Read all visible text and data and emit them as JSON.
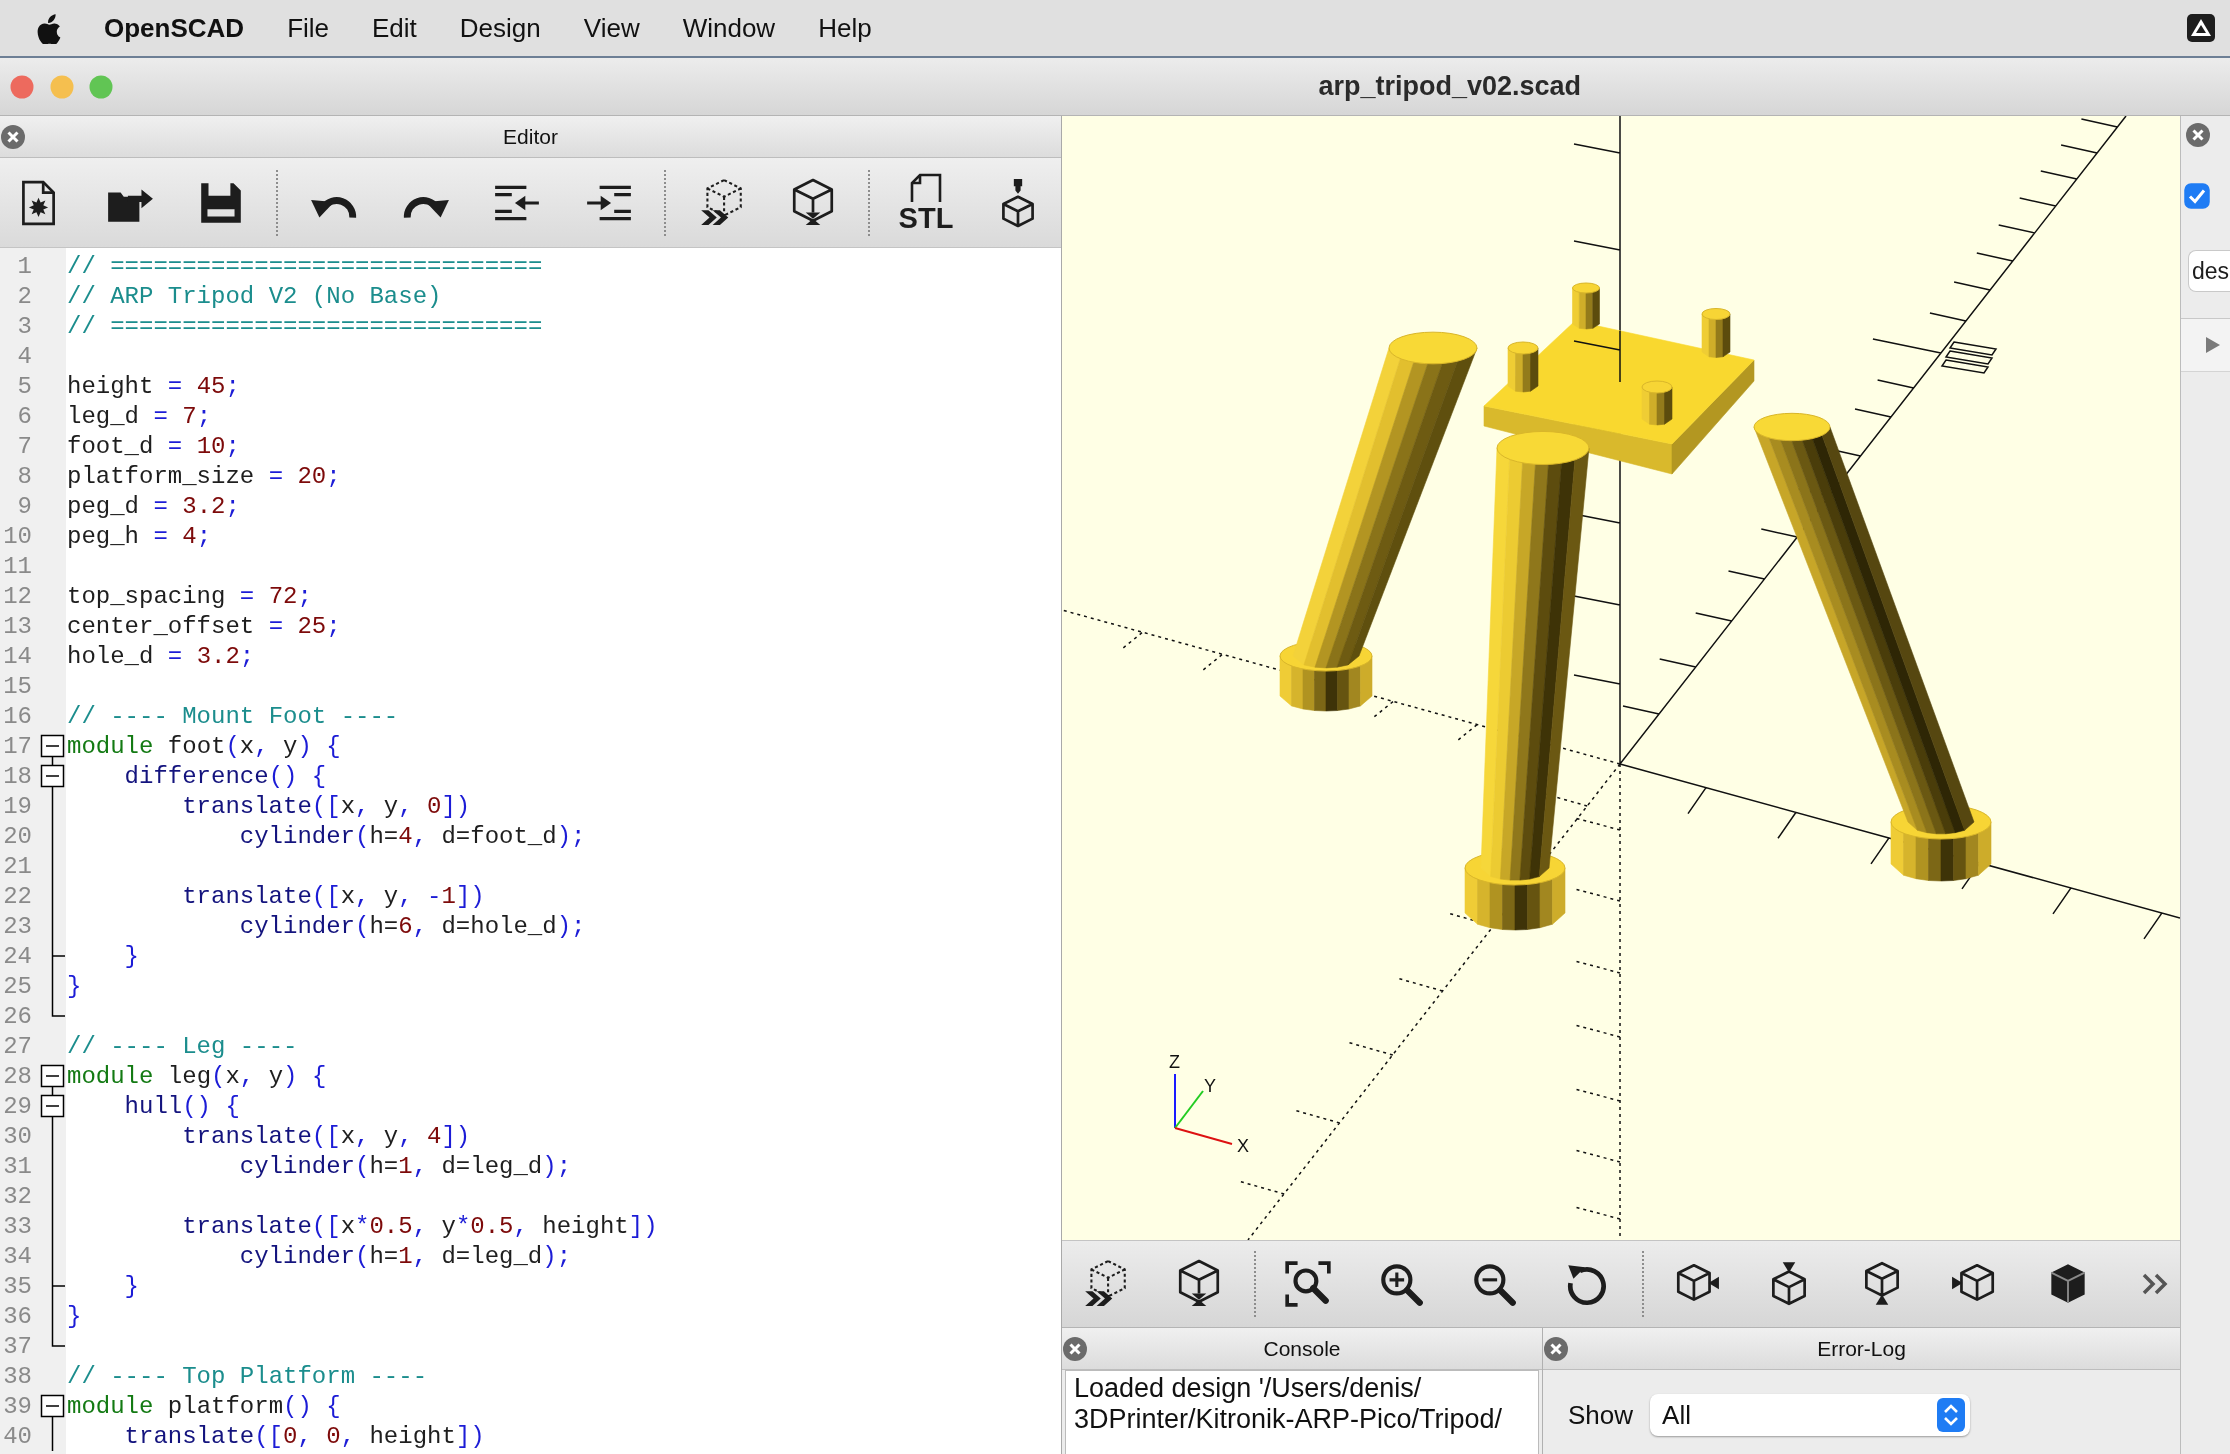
{
  "menu_bar": {
    "app_name": "OpenSCAD",
    "menus": [
      "File",
      "Edit",
      "Design",
      "View",
      "Window",
      "Help"
    ]
  },
  "window": {
    "title": "arp_tripod_v02.scad"
  },
  "editor": {
    "title": "Editor",
    "toolbar": [
      {
        "buttons": [
          {
            "kind": "new"
          },
          {
            "kind": "open"
          },
          {
            "kind": "save"
          }
        ]
      },
      {
        "buttons": [
          {
            "kind": "undo"
          },
          {
            "kind": "redo"
          },
          {
            "kind": "unindent"
          },
          {
            "kind": "indent"
          }
        ]
      },
      {
        "buttons": [
          {
            "kind": "preview"
          },
          {
            "kind": "render"
          }
        ]
      },
      {
        "buttons": [
          {
            "kind": "export_stl",
            "label": "STL"
          },
          {
            "kind": "print"
          }
        ]
      }
    ],
    "lines": [
      {
        "number": "1",
        "tokens": [
          {
            "kind": "comment",
            "text": "// =============================="
          }
        ]
      },
      {
        "number": "2",
        "tokens": [
          {
            "kind": "comment",
            "text": "// ARP Tripod V2 (No Base)"
          }
        ]
      },
      {
        "number": "3",
        "tokens": [
          {
            "kind": "comment",
            "text": "// =============================="
          }
        ]
      },
      {
        "number": "4"
      },
      {
        "number": "5",
        "tokens": [
          {
            "kind": "ident",
            "text": "height "
          },
          {
            "kind": "op",
            "text": "= "
          },
          {
            "kind": "number",
            "text": "45"
          },
          {
            "kind": "op",
            "text": ";"
          }
        ]
      },
      {
        "number": "6",
        "tokens": [
          {
            "kind": "ident",
            "text": "leg_d "
          },
          {
            "kind": "op",
            "text": "= "
          },
          {
            "kind": "number",
            "text": "7"
          },
          {
            "kind": "op",
            "text": ";"
          }
        ]
      },
      {
        "number": "7",
        "tokens": [
          {
            "kind": "ident",
            "text": "foot_d "
          },
          {
            "kind": "op",
            "text": "= "
          },
          {
            "kind": "number",
            "text": "10"
          },
          {
            "kind": "op",
            "text": ";"
          }
        ]
      },
      {
        "number": "8",
        "tokens": [
          {
            "kind": "ident",
            "text": "platform_size "
          },
          {
            "kind": "op",
            "text": "= "
          },
          {
            "kind": "number",
            "text": "20"
          },
          {
            "kind": "op",
            "text": ";"
          }
        ]
      },
      {
        "number": "9",
        "tokens": [
          {
            "kind": "ident",
            "text": "peg_d "
          },
          {
            "kind": "op",
            "text": "= "
          },
          {
            "kind": "number",
            "text": "3.2"
          },
          {
            "kind": "op",
            "text": ";"
          }
        ]
      },
      {
        "number": "10",
        "tokens": [
          {
            "kind": "ident",
            "text": "peg_h "
          },
          {
            "kind": "op",
            "text": "= "
          },
          {
            "kind": "number",
            "text": "4"
          },
          {
            "kind": "op",
            "text": ";"
          }
        ]
      },
      {
        "number": "11"
      },
      {
        "number": "12",
        "tokens": [
          {
            "kind": "ident",
            "text": "top_spacing "
          },
          {
            "kind": "op",
            "text": "= "
          },
          {
            "kind": "number",
            "text": "72"
          },
          {
            "kind": "op",
            "text": ";"
          }
        ]
      },
      {
        "number": "13",
        "tokens": [
          {
            "kind": "ident",
            "text": "center_offset "
          },
          {
            "kind": "op",
            "text": "= "
          },
          {
            "kind": "number",
            "text": "25"
          },
          {
            "kind": "op",
            "text": ";"
          }
        ]
      },
      {
        "number": "14",
        "tokens": [
          {
            "kind": "ident",
            "text": "hole_d "
          },
          {
            "kind": "op",
            "text": "= "
          },
          {
            "kind": "number",
            "text": "3.2"
          },
          {
            "kind": "op",
            "text": ";"
          }
        ]
      },
      {
        "number": "15"
      },
      {
        "number": "16",
        "tokens": [
          {
            "kind": "comment",
            "text": "// ---- Mount Foot ----"
          }
        ]
      },
      {
        "number": "17",
        "fold": {
          "kind": "start"
        },
        "tokens": [
          {
            "kind": "keyword",
            "text": "module "
          },
          {
            "kind": "ident",
            "text": "foot"
          },
          {
            "kind": "op",
            "text": "("
          },
          {
            "kind": "ident",
            "text": "x"
          },
          {
            "kind": "op",
            "text": ", "
          },
          {
            "kind": "ident",
            "text": "y"
          },
          {
            "kind": "op",
            "text": ") {"
          }
        ]
      },
      {
        "number": "18",
        "fold": {
          "kind": "nested_start"
        },
        "tokens": [
          {
            "kind": "builtin",
            "text": "    difference"
          },
          {
            "kind": "op",
            "text": "() {"
          }
        ]
      },
      {
        "number": "19",
        "fold": {
          "kind": "through"
        },
        "tokens": [
          {
            "kind": "builtin",
            "text": "        translate"
          },
          {
            "kind": "op",
            "text": "(["
          },
          {
            "kind": "ident",
            "text": "x"
          },
          {
            "kind": "op",
            "text": ", "
          },
          {
            "kind": "ident",
            "text": "y"
          },
          {
            "kind": "op",
            "text": ", "
          },
          {
            "kind": "number",
            "text": "0"
          },
          {
            "kind": "op",
            "text": "])"
          }
        ]
      },
      {
        "number": "20",
        "fold": {
          "kind": "through"
        },
        "tokens": [
          {
            "kind": "builtin",
            "text": "            cylinder"
          },
          {
            "kind": "op",
            "text": "("
          },
          {
            "kind": "ident",
            "text": "h="
          },
          {
            "kind": "number",
            "text": "4"
          },
          {
            "kind": "op",
            "text": ", "
          },
          {
            "kind": "ident",
            "text": "d=foot_d"
          },
          {
            "kind": "op",
            "text": ");"
          }
        ]
      },
      {
        "number": "21",
        "fold": {
          "kind": "through"
        }
      },
      {
        "number": "22",
        "fold": {
          "kind": "through"
        },
        "tokens": [
          {
            "kind": "builtin",
            "text": "        translate"
          },
          {
            "kind": "op",
            "text": "(["
          },
          {
            "kind": "ident",
            "text": "x"
          },
          {
            "kind": "op",
            "text": ", "
          },
          {
            "kind": "ident",
            "text": "y"
          },
          {
            "kind": "op",
            "text": ", -"
          },
          {
            "kind": "number",
            "text": "1"
          },
          {
            "kind": "op",
            "text": "])"
          }
        ]
      },
      {
        "number": "23",
        "fold": {
          "kind": "through"
        },
        "tokens": [
          {
            "kind": "builtin",
            "text": "            cylinder"
          },
          {
            "kind": "op",
            "text": "("
          },
          {
            "kind": "ident",
            "text": "h="
          },
          {
            "kind": "number",
            "text": "6"
          },
          {
            "kind": "op",
            "text": ", "
          },
          {
            "kind": "ident",
            "text": "d=hole_d"
          },
          {
            "kind": "op",
            "text": ");"
          }
        ]
      },
      {
        "number": "24",
        "fold": {
          "kind": "branch_end"
        },
        "tokens": [
          {
            "kind": "op",
            "text": "    }"
          }
        ]
      },
      {
        "number": "25",
        "fold": {
          "kind": "through"
        },
        "tokens": [
          {
            "kind": "op",
            "text": "}"
          }
        ]
      },
      {
        "number": "26",
        "fold": {
          "kind": "end"
        }
      },
      {
        "number": "27",
        "tokens": [
          {
            "kind": "comment",
            "text": "// ---- Leg ----"
          }
        ]
      },
      {
        "number": "28",
        "fold": {
          "kind": "start"
        },
        "tokens": [
          {
            "kind": "keyword",
            "text": "module "
          },
          {
            "kind": "ident",
            "text": "leg"
          },
          {
            "kind": "op",
            "text": "("
          },
          {
            "kind": "ident",
            "text": "x"
          },
          {
            "kind": "op",
            "text": ", "
          },
          {
            "kind": "ident",
            "text": "y"
          },
          {
            "kind": "op",
            "text": ") {"
          }
        ]
      },
      {
        "number": "29",
        "fold": {
          "kind": "nested_start"
        },
        "tokens": [
          {
            "kind": "builtin",
            "text": "    hull"
          },
          {
            "kind": "op",
            "text": "() {"
          }
        ]
      },
      {
        "number": "30",
        "fold": {
          "kind": "through"
        },
        "tokens": [
          {
            "kind": "builtin",
            "text": "        translate"
          },
          {
            "kind": "op",
            "text": "(["
          },
          {
            "kind": "ident",
            "text": "x"
          },
          {
            "kind": "op",
            "text": ", "
          },
          {
            "kind": "ident",
            "text": "y"
          },
          {
            "kind": "op",
            "text": ", "
          },
          {
            "kind": "number",
            "text": "4"
          },
          {
            "kind": "op",
            "text": "])"
          }
        ]
      },
      {
        "number": "31",
        "fold": {
          "kind": "through"
        },
        "tokens": [
          {
            "kind": "builtin",
            "text": "            cylinder"
          },
          {
            "kind": "op",
            "text": "("
          },
          {
            "kind": "ident",
            "text": "h="
          },
          {
            "kind": "number",
            "text": "1"
          },
          {
            "kind": "op",
            "text": ", "
          },
          {
            "kind": "ident",
            "text": "d=leg_d"
          },
          {
            "kind": "op",
            "text": ");"
          }
        ]
      },
      {
        "number": "32",
        "fold": {
          "kind": "through"
        }
      },
      {
        "number": "33",
        "fold": {
          "kind": "through"
        },
        "tokens": [
          {
            "kind": "builtin",
            "text": "        translate"
          },
          {
            "kind": "op",
            "text": "(["
          },
          {
            "kind": "ident",
            "text": "x"
          },
          {
            "kind": "op",
            "text": "*"
          },
          {
            "kind": "number",
            "text": "0.5"
          },
          {
            "kind": "op",
            "text": ", "
          },
          {
            "kind": "ident",
            "text": "y"
          },
          {
            "kind": "op",
            "text": "*"
          },
          {
            "kind": "number",
            "text": "0.5"
          },
          {
            "kind": "op",
            "text": ", "
          },
          {
            "kind": "ident",
            "text": "height"
          },
          {
            "kind": "op",
            "text": "])"
          }
        ]
      },
      {
        "number": "34",
        "fold": {
          "kind": "through"
        },
        "tokens": [
          {
            "kind": "builtin",
            "text": "            cylinder"
          },
          {
            "kind": "op",
            "text": "("
          },
          {
            "kind": "ident",
            "text": "h="
          },
          {
            "kind": "number",
            "text": "1"
          },
          {
            "kind": "op",
            "text": ", "
          },
          {
            "kind": "ident",
            "text": "d=leg_d"
          },
          {
            "kind": "op",
            "text": ");"
          }
        ]
      },
      {
        "number": "35",
        "fold": {
          "kind": "branch_end"
        },
        "tokens": [
          {
            "kind": "op",
            "text": "    }"
          }
        ]
      },
      {
        "number": "36",
        "fold": {
          "kind": "through"
        },
        "tokens": [
          {
            "kind": "op",
            "text": "}"
          }
        ]
      },
      {
        "number": "37",
        "fold": {
          "kind": "end"
        }
      },
      {
        "number": "38",
        "tokens": [
          {
            "kind": "comment",
            "text": "// ---- Top Platform ----"
          }
        ]
      },
      {
        "number": "39",
        "fold": {
          "kind": "start"
        },
        "tokens": [
          {
            "kind": "keyword",
            "text": "module "
          },
          {
            "kind": "ident",
            "text": "platform"
          },
          {
            "kind": "op",
            "text": "() {"
          }
        ]
      },
      {
        "number": "40",
        "fold": {
          "kind": "through"
        },
        "tokens": [
          {
            "kind": "builtin",
            "text": "    translate"
          },
          {
            "kind": "op",
            "text": "(["
          },
          {
            "kind": "number",
            "text": "0"
          },
          {
            "kind": "op",
            "text": ", "
          },
          {
            "kind": "number",
            "text": "0"
          },
          {
            "kind": "op",
            "text": ", "
          },
          {
            "kind": "ident",
            "text": "height"
          },
          {
            "kind": "op",
            "text": "])"
          }
        ]
      }
    ]
  },
  "viewport": {
    "axis_labels": {
      "x": "X",
      "y": "Y",
      "z": "Z"
    },
    "toolbar": [
      {
        "buttons": [
          {
            "kind": "preview"
          },
          {
            "kind": "render"
          }
        ]
      },
      {
        "buttons": [
          {
            "kind": "view_all"
          },
          {
            "kind": "zoom_in"
          },
          {
            "kind": "zoom_out"
          },
          {
            "kind": "reset_view"
          }
        ]
      },
      {
        "buttons": [
          {
            "kind": "view_right"
          },
          {
            "kind": "view_top"
          },
          {
            "kind": "view_bottom"
          },
          {
            "kind": "view_left"
          },
          {
            "kind": "view_solid"
          }
        ]
      }
    ],
    "overflow_button": true
  },
  "console": {
    "title": "Console",
    "lines": [
      "Loaded design '/Users/denis/",
      "3DPrinter/Kitronik-ARP-Pico/Tripod/"
    ]
  },
  "error_log": {
    "title": "Error-Log",
    "filter": {
      "label": "Show",
      "value": "All"
    }
  },
  "customizer": {
    "checkbox": {
      "checked": true
    },
    "field": {
      "value": "des"
    }
  }
}
